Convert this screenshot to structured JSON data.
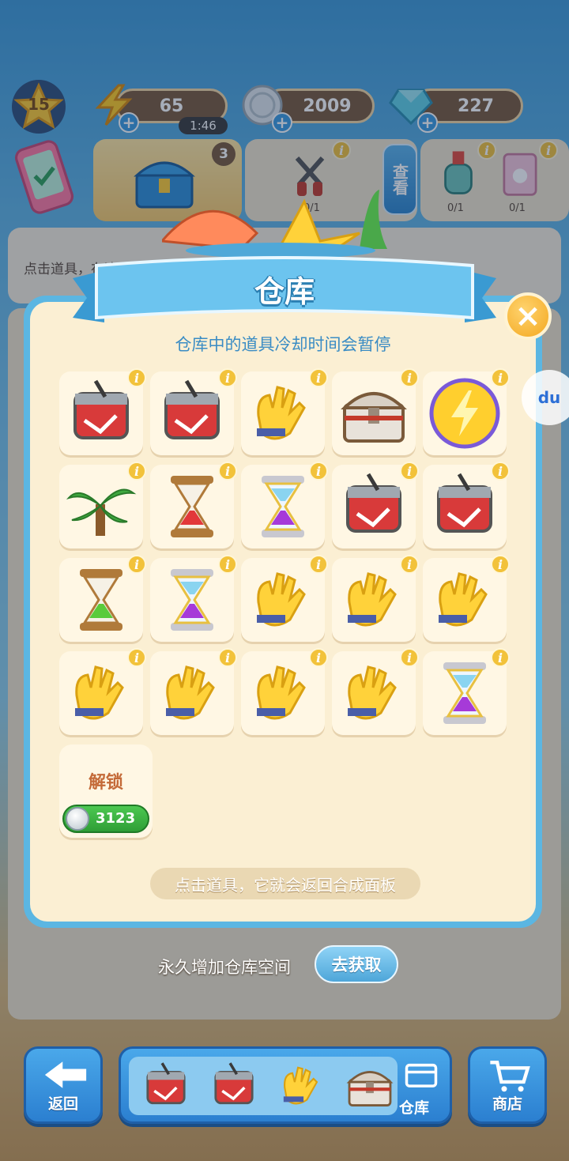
{
  "hud": {
    "level": "15",
    "energy": "65",
    "energy_timer": "1:46",
    "coins": "2009",
    "gems": "227"
  },
  "orders": {
    "chest_badge": "3",
    "view_button": "查看",
    "progress_a": "0/1",
    "progress_b": "0/1",
    "progress_c": "0/1"
  },
  "hint_strip": "点击道具，在这",
  "modal": {
    "title": "仓库",
    "subtitle": "仓库中的道具冷却时间会暂停",
    "footer_tip": "点击道具，它就会返回合成面板",
    "unlock_label": "解锁",
    "unlock_price": "3123"
  },
  "storage_items": [
    "paint-bucket-icon",
    "paint-bucket-icon",
    "gloves-icon",
    "treasure-chest-icon",
    "energy-orb-icon",
    "palm-plant-icon",
    "red-hourglass-icon",
    "purple-hourglass-icon",
    "paint-bucket-icon",
    "paint-bucket-icon",
    "green-hourglass-icon",
    "purple-hourglass-icon",
    "gloves-icon",
    "gloves-icon",
    "gloves-icon",
    "gloves-icon",
    "gloves-icon",
    "gloves-icon",
    "gloves-icon",
    "purple-hourglass-icon"
  ],
  "expand": {
    "text": "永久增加仓库空间",
    "button": "去获取"
  },
  "bottom": {
    "back": "返回",
    "storage": "仓库",
    "shop": "商店"
  },
  "watermark": "du"
}
